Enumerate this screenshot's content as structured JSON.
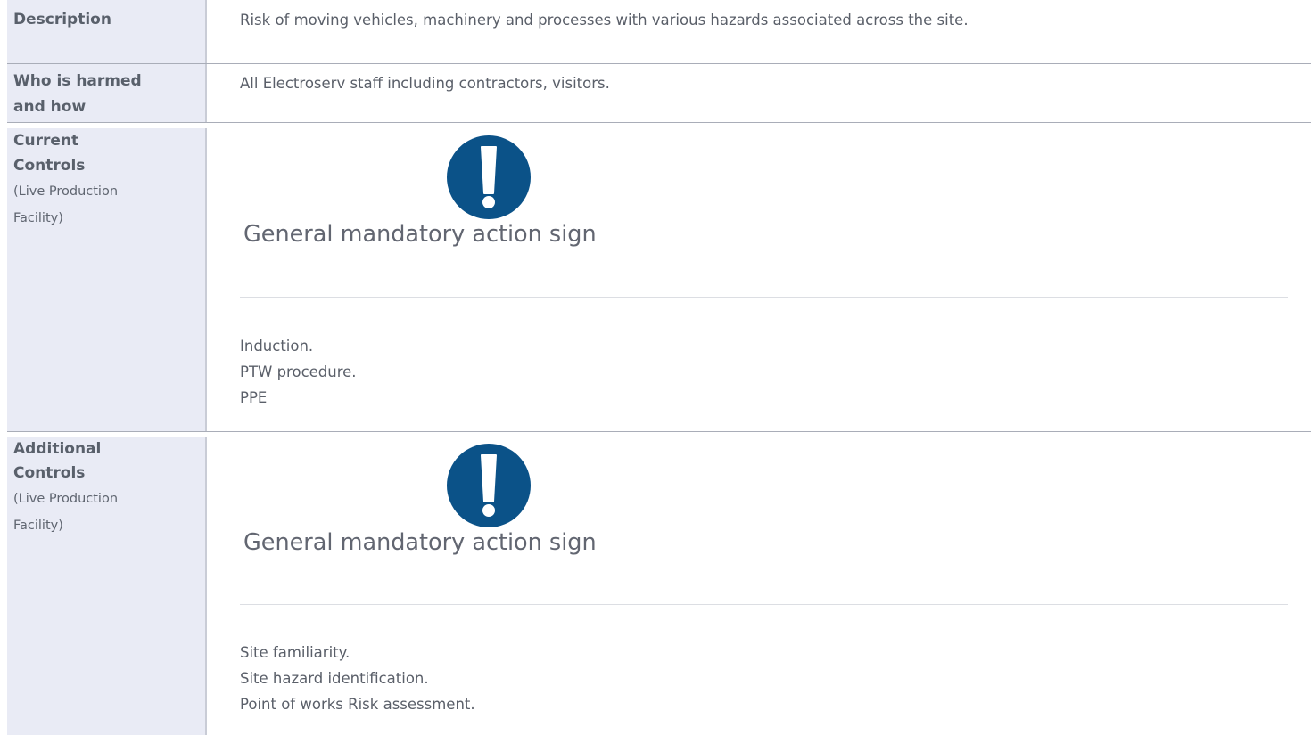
{
  "rows": {
    "description": {
      "label": "Description",
      "value": "Risk of moving vehicles, machinery and processes with various hazards associated across the site."
    },
    "who_harmed": {
      "label_line1": "Who is harmed",
      "label_line2": "and how",
      "value": "All Electroserv staff including contractors, visitors."
    },
    "current_controls": {
      "label_line1": "Current",
      "label_line2": "Controls",
      "sub_line1": "(Live Production",
      "sub_line2": "Facility)",
      "sign_icon": "mandatory-action-icon",
      "sign_caption": "General mandatory action sign",
      "items": [
        "Induction.",
        "PTW procedure.",
        "PPE"
      ]
    },
    "additional_controls": {
      "label_line1": "Additional",
      "label_line2": "Controls",
      "sub_line1": "(Live Production",
      "sub_line2": "Facility)",
      "sign_icon": "mandatory-action-icon",
      "sign_caption": "General mandatory action sign",
      "items": [
        "Site familiarity.",
        "Site hazard identification.",
        "Point of works Risk assessment."
      ]
    }
  },
  "colors": {
    "label_bg": "#e9ebf5",
    "sign_blue": "#0b5288",
    "text": "#5a5f69"
  }
}
